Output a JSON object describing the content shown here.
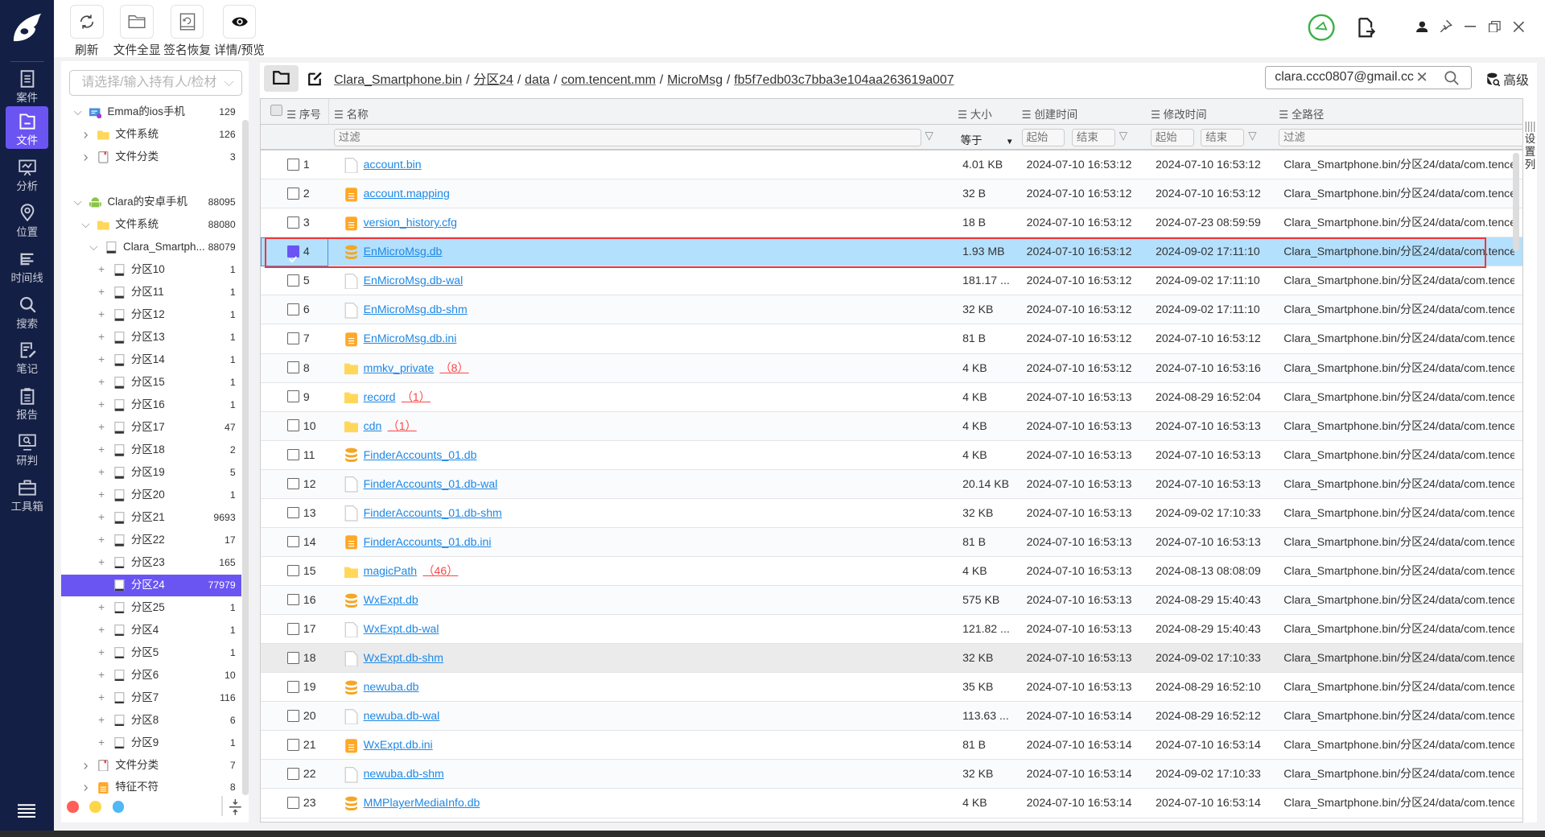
{
  "sidebar": {
    "items": [
      {
        "key": "case",
        "label": "案件"
      },
      {
        "key": "file",
        "label": "文件",
        "active": true
      },
      {
        "key": "analysis",
        "label": "分析"
      },
      {
        "key": "location",
        "label": "位置"
      },
      {
        "key": "timeline",
        "label": "时间线"
      },
      {
        "key": "search",
        "label": "搜索"
      },
      {
        "key": "notes",
        "label": "笔记"
      },
      {
        "key": "report",
        "label": "报告"
      },
      {
        "key": "research",
        "label": "研判"
      },
      {
        "key": "toolbox",
        "label": "工具箱"
      }
    ]
  },
  "toolbar": {
    "buttons": [
      {
        "key": "refresh",
        "label": "刷新",
        "icon": "refresh-icon"
      },
      {
        "key": "show-all",
        "label": "文件全显",
        "icon": "folder-icon"
      },
      {
        "key": "signature-recover",
        "label": "签名恢复",
        "icon": "recover-icon"
      },
      {
        "key": "detail-preview",
        "label": "详情/预览",
        "icon": "eye-icon"
      }
    ]
  },
  "left": {
    "owner_placeholder": "请选择/输入持有人/检材",
    "tree": [
      {
        "label": "Emma的ios手机",
        "count": "129",
        "level": 0,
        "toggle": "open",
        "icon": "ios"
      },
      {
        "label": "文件系统",
        "count": "126",
        "level": 1,
        "toggle": "closed",
        "icon": "folder"
      },
      {
        "label": "文件分类",
        "count": "3",
        "level": 1,
        "toggle": "closed",
        "icon": "doc"
      },
      {
        "gap": true
      },
      {
        "label": "Clara的安卓手机",
        "count": "88095",
        "level": 0,
        "toggle": "open",
        "icon": "android"
      },
      {
        "label": "文件系统",
        "count": "88080",
        "level": 1,
        "toggle": "open",
        "icon": "folder"
      },
      {
        "label": "Clara_Smartph...",
        "count": "88079",
        "level": 2,
        "toggle": "open",
        "icon": "disk"
      },
      {
        "label": "分区10",
        "count": "1",
        "level": 3,
        "toggle": "plus",
        "icon": "disk"
      },
      {
        "label": "分区11",
        "count": "1",
        "level": 3,
        "toggle": "plus",
        "icon": "disk"
      },
      {
        "label": "分区12",
        "count": "1",
        "level": 3,
        "toggle": "plus",
        "icon": "disk"
      },
      {
        "label": "分区13",
        "count": "1",
        "level": 3,
        "toggle": "plus",
        "icon": "disk"
      },
      {
        "label": "分区14",
        "count": "1",
        "level": 3,
        "toggle": "plus",
        "icon": "disk"
      },
      {
        "label": "分区15",
        "count": "1",
        "level": 3,
        "toggle": "plus",
        "icon": "disk"
      },
      {
        "label": "分区16",
        "count": "1",
        "level": 3,
        "toggle": "plus",
        "icon": "disk"
      },
      {
        "label": "分区17",
        "count": "47",
        "level": 3,
        "toggle": "plus",
        "icon": "disk"
      },
      {
        "label": "分区18",
        "count": "2",
        "level": 3,
        "toggle": "plus",
        "icon": "disk"
      },
      {
        "label": "分区19",
        "count": "5",
        "level": 3,
        "toggle": "plus",
        "icon": "disk"
      },
      {
        "label": "分区20",
        "count": "1",
        "level": 3,
        "toggle": "plus",
        "icon": "disk"
      },
      {
        "label": "分区21",
        "count": "9693",
        "level": 3,
        "toggle": "plus",
        "icon": "disk"
      },
      {
        "label": "分区22",
        "count": "17",
        "level": 3,
        "toggle": "plus",
        "icon": "disk"
      },
      {
        "label": "分区23",
        "count": "165",
        "level": 3,
        "toggle": "plus",
        "icon": "disk"
      },
      {
        "label": "分区24",
        "count": "77979",
        "level": 3,
        "toggle": "none",
        "icon": "disk",
        "selected": true
      },
      {
        "label": "分区25",
        "count": "1",
        "level": 3,
        "toggle": "plus",
        "icon": "disk"
      },
      {
        "label": "分区4",
        "count": "1",
        "level": 3,
        "toggle": "plus",
        "icon": "disk"
      },
      {
        "label": "分区5",
        "count": "1",
        "level": 3,
        "toggle": "plus",
        "icon": "disk"
      },
      {
        "label": "分区6",
        "count": "10",
        "level": 3,
        "toggle": "plus",
        "icon": "disk"
      },
      {
        "label": "分区7",
        "count": "116",
        "level": 3,
        "toggle": "plus",
        "icon": "disk"
      },
      {
        "label": "分区8",
        "count": "6",
        "level": 3,
        "toggle": "plus",
        "icon": "disk"
      },
      {
        "label": "分区9",
        "count": "1",
        "level": 3,
        "toggle": "plus",
        "icon": "disk"
      },
      {
        "label": "文件分类",
        "count": "7",
        "level": 1,
        "toggle": "closed",
        "icon": "doc"
      },
      {
        "label": "特征不符",
        "count": "8",
        "level": 1,
        "toggle": "closed",
        "icon": "orangedoc"
      }
    ],
    "dots": [
      "#ff5f57",
      "#ffd54a",
      "#4fb8f5"
    ]
  },
  "breadcrumb": [
    "Clara_Smartphone.bin",
    "分区24",
    "data",
    "com.tencent.mm",
    "MicroMsg",
    "fb5f7edb03c7bba3e104aa263619a007"
  ],
  "search": {
    "value": "clara.ccc0807@gmail.cc",
    "advanced_label": "高级"
  },
  "table": {
    "headers": {
      "index": "序号",
      "name": "名称",
      "size": "大小",
      "created": "创建时间",
      "modified": "修改时间",
      "path": "全路径"
    },
    "filters": {
      "name": "过滤",
      "size_op": "等于",
      "start": "起始",
      "end": "结束",
      "path": "过滤"
    },
    "settings_label": "设置列",
    "rows": [
      {
        "n": "1",
        "name": "account.bin",
        "type": "file",
        "size": "4.01 KB",
        "created": "2024-07-10 16:53:12",
        "modified": "2024-07-10 16:53:12"
      },
      {
        "n": "2",
        "name": "account.mapping",
        "type": "doc",
        "size": "32 B",
        "created": "2024-07-10 16:53:12",
        "modified": "2024-07-10 16:53:12"
      },
      {
        "n": "3",
        "name": "version_history.cfg",
        "type": "doc",
        "size": "18 B",
        "created": "2024-07-10 16:53:12",
        "modified": "2024-07-23 08:59:59"
      },
      {
        "n": "4",
        "name": "EnMicroMsg.db",
        "type": "db",
        "size": "1.93 MB",
        "created": "2024-07-10 16:53:12",
        "modified": "2024-09-02 17:11:10",
        "selected": true
      },
      {
        "n": "5",
        "name": "EnMicroMsg.db-wal",
        "type": "file",
        "size": "181.17 ...",
        "created": "2024-07-10 16:53:12",
        "modified": "2024-09-02 17:11:10"
      },
      {
        "n": "6",
        "name": "EnMicroMsg.db-shm",
        "type": "file",
        "size": "32 KB",
        "created": "2024-07-10 16:53:12",
        "modified": "2024-09-02 17:11:10"
      },
      {
        "n": "7",
        "name": "EnMicroMsg.db.ini",
        "type": "doc",
        "size": "81 B",
        "created": "2024-07-10 16:53:12",
        "modified": "2024-07-10 16:53:12"
      },
      {
        "n": "8",
        "name": "mmkv_private",
        "type": "folder",
        "count": "（8）",
        "size": "4 KB",
        "created": "2024-07-10 16:53:12",
        "modified": "2024-07-10 16:53:16"
      },
      {
        "n": "9",
        "name": "record",
        "type": "folder",
        "count": "（1）",
        "size": "4 KB",
        "created": "2024-07-10 16:53:13",
        "modified": "2024-08-29 16:52:04"
      },
      {
        "n": "10",
        "name": "cdn",
        "type": "folder",
        "count": "（1）",
        "size": "4 KB",
        "created": "2024-07-10 16:53:13",
        "modified": "2024-07-10 16:53:13"
      },
      {
        "n": "11",
        "name": "FinderAccounts_01.db",
        "type": "db",
        "size": "4 KB",
        "created": "2024-07-10 16:53:13",
        "modified": "2024-07-10 16:53:13"
      },
      {
        "n": "12",
        "name": "FinderAccounts_01.db-wal",
        "type": "file",
        "size": "20.14 KB",
        "created": "2024-07-10 16:53:13",
        "modified": "2024-07-10 16:53:13"
      },
      {
        "n": "13",
        "name": "FinderAccounts_01.db-shm",
        "type": "file",
        "size": "32 KB",
        "created": "2024-07-10 16:53:13",
        "modified": "2024-09-02 17:10:33"
      },
      {
        "n": "14",
        "name": "FinderAccounts_01.db.ini",
        "type": "doc",
        "size": "81 B",
        "created": "2024-07-10 16:53:13",
        "modified": "2024-07-10 16:53:13"
      },
      {
        "n": "15",
        "name": "magicPath",
        "type": "folder",
        "count": "（46）",
        "size": "4 KB",
        "created": "2024-07-10 16:53:13",
        "modified": "2024-08-13 08:08:09"
      },
      {
        "n": "16",
        "name": "WxExpt.db",
        "type": "db",
        "size": "575 KB",
        "created": "2024-07-10 16:53:13",
        "modified": "2024-08-29 15:40:43"
      },
      {
        "n": "17",
        "name": "WxExpt.db-wal",
        "type": "file",
        "size": "121.82 ...",
        "created": "2024-07-10 16:53:13",
        "modified": "2024-08-29 15:40:43"
      },
      {
        "n": "18",
        "name": "WxExpt.db-shm",
        "type": "file",
        "size": "32 KB",
        "created": "2024-07-10 16:53:13",
        "modified": "2024-09-02 17:10:33",
        "hover": true
      },
      {
        "n": "19",
        "name": "newuba.db",
        "type": "db",
        "size": "35 KB",
        "created": "2024-07-10 16:53:13",
        "modified": "2024-08-29 16:52:10"
      },
      {
        "n": "20",
        "name": "newuba.db-wal",
        "type": "file",
        "size": "113.63 ...",
        "created": "2024-07-10 16:53:14",
        "modified": "2024-08-29 16:52:12"
      },
      {
        "n": "21",
        "name": "WxExpt.db.ini",
        "type": "doc",
        "size": "81 B",
        "created": "2024-07-10 16:53:14",
        "modified": "2024-07-10 16:53:14"
      },
      {
        "n": "22",
        "name": "newuba.db-shm",
        "type": "file",
        "size": "32 KB",
        "created": "2024-07-10 16:53:14",
        "modified": "2024-09-02 17:10:33"
      },
      {
        "n": "23",
        "name": "MMPlayerMediaInfo.db",
        "type": "db",
        "size": "4 KB",
        "created": "2024-07-10 16:53:14",
        "modified": "2024-07-10 16:53:14"
      }
    ],
    "path_text": "Clara_Smartphone.bin/分区24/data/com.tence"
  },
  "colors": {
    "accent": "#6a55f3",
    "sidebar": "#131f44",
    "link": "#1e88e5",
    "selected_row": "#b3e0fd",
    "highlight_box": "#f0353a"
  }
}
